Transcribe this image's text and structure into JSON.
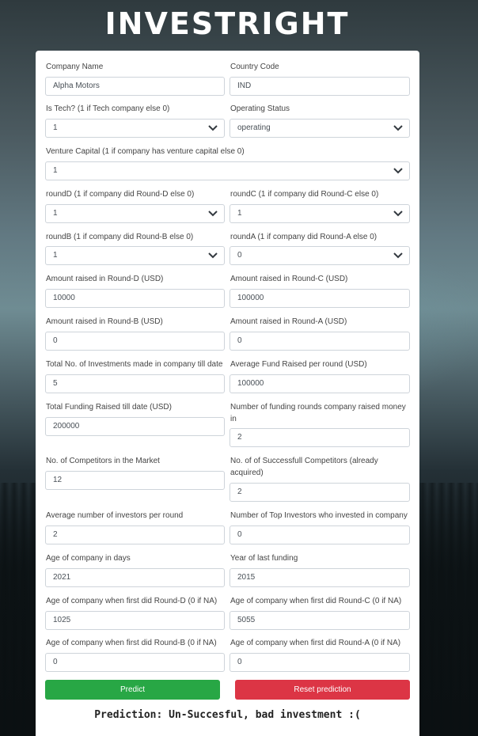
{
  "app_title": "INVESTRIGHT",
  "fields": {
    "company_name": {
      "label": "Company Name",
      "value": "Alpha Motors"
    },
    "country_code": {
      "label": "Country Code",
      "value": "IND"
    },
    "is_tech": {
      "label": "Is Tech? (1 if Tech company else 0)",
      "value": "1"
    },
    "operating_status": {
      "label": "Operating Status",
      "value": "operating"
    },
    "venture_capital": {
      "label": "Venture Capital (1 if company has venture capital else 0)",
      "value": "1"
    },
    "round_d": {
      "label": "roundD (1 if company did Round-D else 0)",
      "value": "1"
    },
    "round_c": {
      "label": "roundC (1 if company did Round-C else 0)",
      "value": "1"
    },
    "round_b": {
      "label": "roundB (1 if company did Round-B else 0)",
      "value": "1"
    },
    "round_a": {
      "label": "roundA (1 if company did Round-A else 0)",
      "value": "0"
    },
    "amount_d": {
      "label": "Amount raised in Round-D (USD)",
      "value": "10000"
    },
    "amount_c": {
      "label": "Amount raised in Round-C (USD)",
      "value": "100000"
    },
    "amount_b": {
      "label": "Amount raised in Round-B (USD)",
      "value": "0"
    },
    "amount_a": {
      "label": "Amount raised in Round-A (USD)",
      "value": "0"
    },
    "total_investments": {
      "label": "Total No. of Investments made in company till date",
      "value": "5"
    },
    "avg_fund": {
      "label": "Average Fund Raised per round (USD)",
      "value": "100000"
    },
    "total_funding": {
      "label": "Total Funding Raised till date (USD)",
      "value": "200000"
    },
    "num_rounds": {
      "label_line1": "Number of funding rounds company raised money",
      "label_line2": "in",
      "value": "2"
    },
    "competitors": {
      "label": "No. of Competitors in the Market",
      "value": "12"
    },
    "successful_competitors": {
      "label_line1": "No. of of Successfull Competitors (already",
      "label_line2": "acquired)",
      "value": "2"
    },
    "avg_investors": {
      "label": "Average number of investors per round",
      "value": "2"
    },
    "top_investors": {
      "label": "Number of Top Investors who invested in company",
      "value": "0"
    },
    "age_days": {
      "label": "Age of company in days",
      "value": "2021"
    },
    "last_funding_year": {
      "label": "Year of last funding",
      "value": "2015"
    },
    "age_round_d": {
      "label": "Age of company when first did Round-D (0 if NA)",
      "value": "1025"
    },
    "age_round_c": {
      "label": "Age of company when first did Round-C (0 if NA)",
      "value": "5055"
    },
    "age_round_b": {
      "label": "Age of company when first did Round-B (0 if NA)",
      "value": "0"
    },
    "age_round_a": {
      "label": "Age of company when first did Round-A (0 if NA)",
      "value": "0"
    }
  },
  "buttons": {
    "predict": "Predict",
    "reset": "Reset prediction"
  },
  "prediction_text": "Prediction: Un-Succesful, bad investment :(",
  "colors": {
    "predict": "#28a745",
    "reset": "#dc3545"
  }
}
